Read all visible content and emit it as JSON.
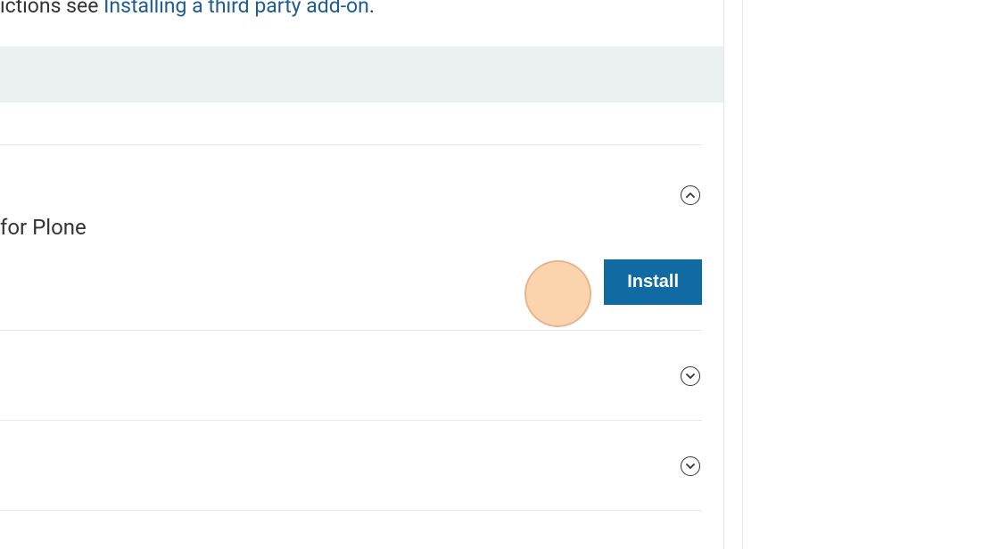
{
  "intro": {
    "text_fragment": "ictions see ",
    "link_text": "Installing a third party add-on",
    "period": "."
  },
  "addons": {
    "expanded": {
      "description_fragment": " for Plone",
      "install_label": "Install"
    }
  }
}
